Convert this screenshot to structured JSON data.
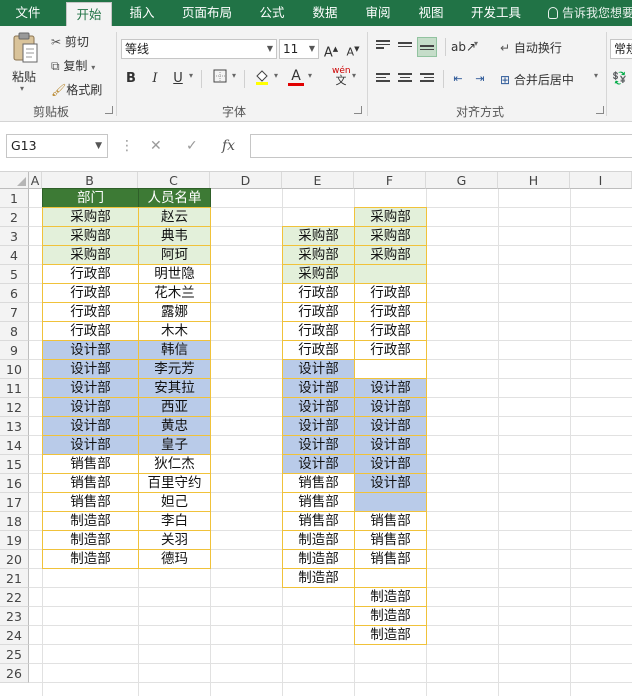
{
  "menu": {
    "tabs": [
      {
        "label": "文件",
        "active": false
      },
      {
        "label": "开始",
        "active": true
      },
      {
        "label": "插入",
        "active": false
      },
      {
        "label": "页面布局",
        "active": false
      },
      {
        "label": "公式",
        "active": false
      },
      {
        "label": "数据",
        "active": false
      },
      {
        "label": "审阅",
        "active": false
      },
      {
        "label": "视图",
        "active": false
      },
      {
        "label": "开发工具",
        "active": false
      }
    ],
    "tell_me": "告诉我您想要"
  },
  "ribbon": {
    "clipboard": {
      "paste": "粘贴",
      "cut": "剪切",
      "copy": "复制",
      "format_painter": "格式刷",
      "group": "剪贴板"
    },
    "font": {
      "name": "等线",
      "size": "11",
      "bold": "B",
      "italic": "I",
      "underline": "U",
      "wen": "wén",
      "group": "字体",
      "font_color": "#e00000"
    },
    "alignment": {
      "wrap": "自动换行",
      "merge": "合并后居中",
      "group": "对齐方式"
    },
    "number": {
      "format": "常规"
    }
  },
  "formula_bar": {
    "name_box": "G13",
    "formula": ""
  },
  "grid": {
    "columns": [
      "A",
      "B",
      "C",
      "D",
      "E",
      "F",
      "G",
      "H",
      "I"
    ],
    "rows": [
      "1",
      "2",
      "3",
      "4",
      "5",
      "6",
      "7",
      "8",
      "9",
      "10",
      "11",
      "12",
      "13",
      "14",
      "15",
      "16",
      "17",
      "18",
      "19",
      "20",
      "21",
      "22",
      "23",
      "24",
      "25",
      "26"
    ],
    "colors": {
      "header": "#3d7a35",
      "green": "#e3f0da",
      "blue": "#b9cbe9",
      "border": "#f0c23a"
    },
    "table": {
      "headers": [
        "部门",
        "人员名单"
      ],
      "rows": [
        {
          "dept": "采购部",
          "name": "赵云",
          "fill": "green"
        },
        {
          "dept": "采购部",
          "name": "典韦",
          "fill": "green"
        },
        {
          "dept": "采购部",
          "name": "阿珂",
          "fill": "green"
        },
        {
          "dept": "行政部",
          "name": "明世隐",
          "fill": "plain"
        },
        {
          "dept": "行政部",
          "name": "花木兰",
          "fill": "plain"
        },
        {
          "dept": "行政部",
          "name": "露娜",
          "fill": "plain"
        },
        {
          "dept": "行政部",
          "name": "木木",
          "fill": "plain"
        },
        {
          "dept": "设计部",
          "name": "韩信",
          "fill": "blue"
        },
        {
          "dept": "设计部",
          "name": "李元芳",
          "fill": "blue"
        },
        {
          "dept": "设计部",
          "name": "安其拉",
          "fill": "blue"
        },
        {
          "dept": "设计部",
          "name": "西亚",
          "fill": "blue"
        },
        {
          "dept": "设计部",
          "name": "黄忠",
          "fill": "blue"
        },
        {
          "dept": "设计部",
          "name": "皇子",
          "fill": "blue"
        },
        {
          "dept": "销售部",
          "name": "狄仁杰",
          "fill": "plain"
        },
        {
          "dept": "销售部",
          "name": "百里守约",
          "fill": "plain"
        },
        {
          "dept": "销售部",
          "name": "妲己",
          "fill": "plain"
        },
        {
          "dept": "制造部",
          "name": "李白",
          "fill": "plain"
        },
        {
          "dept": "制造部",
          "name": "关羽",
          "fill": "plain"
        },
        {
          "dept": "制造部",
          "name": "德玛",
          "fill": "plain"
        }
      ]
    },
    "col_e": [
      {
        "row": 3,
        "text": "采购部",
        "fill": "green"
      },
      {
        "row": 4,
        "text": "采购部",
        "fill": "green"
      },
      {
        "row": 5,
        "text": "采购部",
        "fill": "green"
      },
      {
        "row": 6,
        "text": "行政部",
        "fill": "plain"
      },
      {
        "row": 7,
        "text": "行政部",
        "fill": "plain"
      },
      {
        "row": 8,
        "text": "行政部",
        "fill": "plain"
      },
      {
        "row": 9,
        "text": "行政部",
        "fill": "plain"
      },
      {
        "row": 10,
        "text": "设计部",
        "fill": "blue"
      },
      {
        "row": 11,
        "text": "设计部",
        "fill": "blue"
      },
      {
        "row": 12,
        "text": "设计部",
        "fill": "blue"
      },
      {
        "row": 13,
        "text": "设计部",
        "fill": "blue"
      },
      {
        "row": 14,
        "text": "设计部",
        "fill": "blue"
      },
      {
        "row": 15,
        "text": "设计部",
        "fill": "blue"
      },
      {
        "row": 16,
        "text": "销售部",
        "fill": "plain"
      },
      {
        "row": 17,
        "text": "销售部",
        "fill": "plain"
      },
      {
        "row": 18,
        "text": "销售部",
        "fill": "plain"
      },
      {
        "row": 19,
        "text": "制造部",
        "fill": "plain"
      },
      {
        "row": 20,
        "text": "制造部",
        "fill": "plain"
      },
      {
        "row": 21,
        "text": "制造部",
        "fill": "plain"
      }
    ],
    "col_f": [
      {
        "row": 2,
        "text": "采购部",
        "fill": "green"
      },
      {
        "row": 3,
        "text": "采购部",
        "fill": "green"
      },
      {
        "row": 4,
        "text": "采购部",
        "fill": "green"
      },
      {
        "row": 5,
        "text": "",
        "fill": "green"
      },
      {
        "row": 6,
        "text": "行政部",
        "fill": "plain"
      },
      {
        "row": 7,
        "text": "行政部",
        "fill": "plain"
      },
      {
        "row": 8,
        "text": "行政部",
        "fill": "plain"
      },
      {
        "row": 9,
        "text": "行政部",
        "fill": "plain"
      },
      {
        "row": 10,
        "text": "",
        "fill": "plain"
      },
      {
        "row": 11,
        "text": "设计部",
        "fill": "blue"
      },
      {
        "row": 12,
        "text": "设计部",
        "fill": "blue"
      },
      {
        "row": 13,
        "text": "设计部",
        "fill": "blue"
      },
      {
        "row": 14,
        "text": "设计部",
        "fill": "blue"
      },
      {
        "row": 15,
        "text": "设计部",
        "fill": "blue"
      },
      {
        "row": 16,
        "text": "设计部",
        "fill": "blue"
      },
      {
        "row": 17,
        "text": "",
        "fill": "blue"
      },
      {
        "row": 18,
        "text": "销售部",
        "fill": "plain"
      },
      {
        "row": 19,
        "text": "销售部",
        "fill": "plain"
      },
      {
        "row": 20,
        "text": "销售部",
        "fill": "plain"
      },
      {
        "row": 21,
        "text": "",
        "fill": "plain"
      },
      {
        "row": 22,
        "text": "制造部",
        "fill": "plain"
      },
      {
        "row": 23,
        "text": "制造部",
        "fill": "plain"
      },
      {
        "row": 24,
        "text": "制造部",
        "fill": "plain"
      }
    ]
  }
}
